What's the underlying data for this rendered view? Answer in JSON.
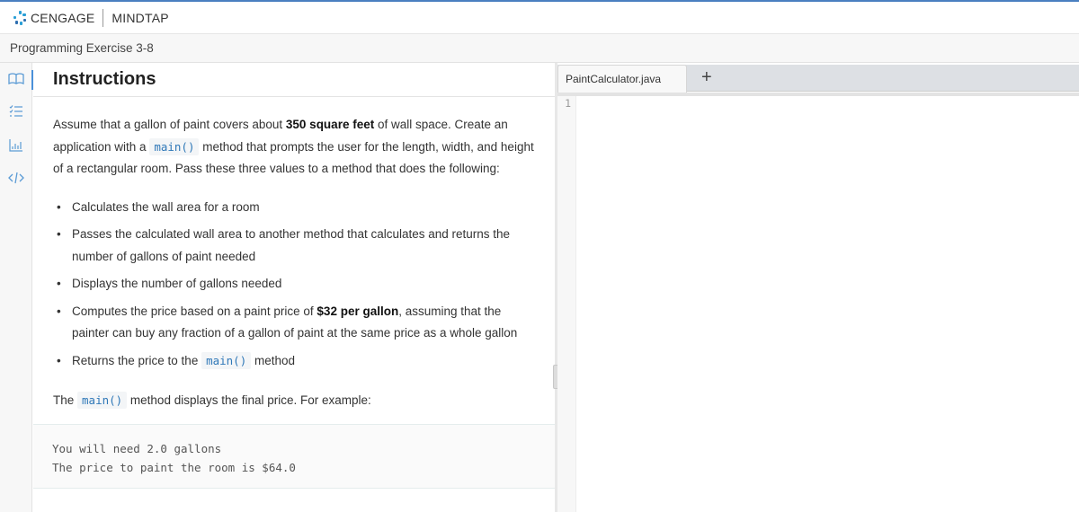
{
  "header": {
    "brand": "CENGAGE",
    "product": "MINDTAP"
  },
  "subheader": {
    "title": "Programming Exercise 3-8"
  },
  "rail": {
    "items": [
      {
        "icon": "book-icon",
        "label": "Instructions",
        "active": true
      },
      {
        "icon": "checklist-icon",
        "label": "Tasks"
      },
      {
        "icon": "bar-chart-icon",
        "label": "Results"
      },
      {
        "icon": "code-icon",
        "label": "Code"
      }
    ]
  },
  "instructions": {
    "heading": "Instructions",
    "intro": {
      "t1": "Assume that a gallon of paint covers about ",
      "b1": "350 square feet",
      "t2": " of wall space. Create an application with a ",
      "code1": "main()",
      "t3": " method that prompts the user for the length, width, and height of a rectangular room. Pass these three values to a method that does the following:"
    },
    "bullets": [
      {
        "text": "Calculates the wall area for a room"
      },
      {
        "text": "Passes the calculated wall area to another method that calculates and returns the number of gallons of paint needed"
      },
      {
        "text": "Displays the number of gallons needed"
      },
      {
        "pre": "Computes the price based on a paint price of ",
        "bold": "$32 per gallon",
        "post": ", assuming that the painter can buy any fraction of a gallon of paint at the same price as a whole gallon"
      },
      {
        "pre": "Returns the price to the ",
        "code": "main()",
        "post": " method"
      }
    ],
    "closing": {
      "pre": "The ",
      "code": "main()",
      "post": " method displays the final price. For example:"
    },
    "example_output": [
      "You will need 2.0 gallons",
      "The price to paint the room is $64.0"
    ]
  },
  "editor": {
    "tab_label": "PaintCalculator.java",
    "add_tab_label": "+",
    "line_numbers": [
      "1"
    ]
  }
}
